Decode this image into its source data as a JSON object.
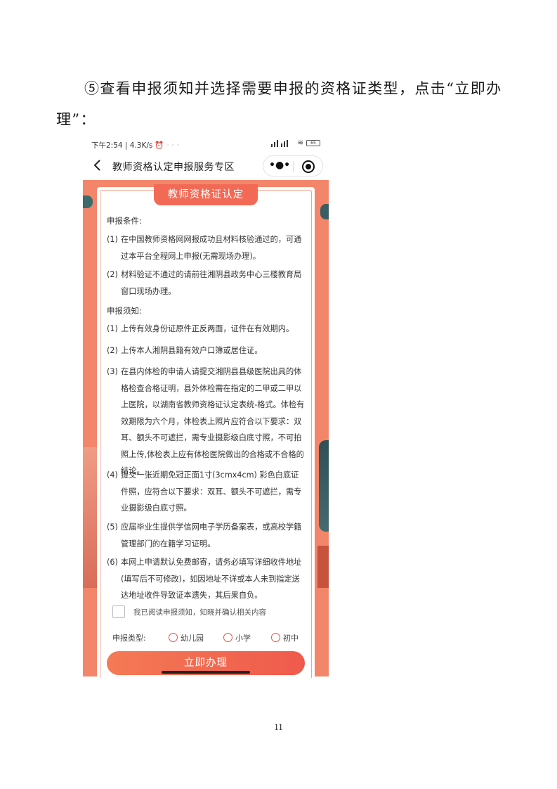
{
  "instruction": "⑤查看申报须知并选择需要申报的资格证类型，点击“立即办理”：",
  "page_number": "11",
  "phone": {
    "status": {
      "time_speed": "下午2:54 | 4.3K/s",
      "battery": "65"
    },
    "nav_title": "教师资格认定申报服务专区",
    "card_title": "教师资格证认定",
    "conditions_title": "申报条件:",
    "conditions": [
      {
        "num": "(1)",
        "text": "在中国教师资格网网报成功且材料核验通过的，可通过本平台全程网上申报(无需现场办理)。"
      },
      {
        "num": "(2)",
        "text": "材料验证不通过的请前往湘阴县政务中心三楼教育局窗口现场办理。"
      }
    ],
    "notice_title": "申报须知:",
    "notices": [
      {
        "num": "(1)",
        "text": "上传有效身份证原件正反两面，证件在有效期内。"
      },
      {
        "num": "(2)",
        "text": "上传本人湘阴县籍有效户口簿或居住证。"
      },
      {
        "num": "(3)",
        "text": "在县内体检的申请人请提交湘阴县县级医院出具的体格检查合格证明，县外体检需在指定的二甲或二甲以上医院，以湖南省教师资格证认定表统-格式。体检有效期限为六个月，体检表上照片应符合以下要求：双耳、额头不可遮拦，需专业摄影级白底寸照，不可拍照上传,体检表上应有体检医院做出的合格或不合格的结论。"
      },
      {
        "num": "(4)",
        "text": "提交一张近期免冠正面1寸(3cmx4cm) 彩色白底证件照，应符合以下要求：双耳、额头不可遮拦，需专业摄影级白底寸照。"
      },
      {
        "num": "(5)",
        "text": "应届毕业生提供学信网电子学历备案表，或高校学籍管理部门的在籍学习证明。"
      },
      {
        "num": "(6)",
        "text": "本网上申请默认免费邮寄，请务必填写详细收件地址(填写后不可修改)，如因地址不详或本人未到指定送达地址收件导致证本遗失，其后果自负。"
      }
    ],
    "agree_text": "我已阅读申报须知，知晓并确认相关内容",
    "type_label": "申报类型:",
    "types": [
      "幼儿园",
      "小学",
      "初中"
    ],
    "submit_label": "立即办理"
  }
}
